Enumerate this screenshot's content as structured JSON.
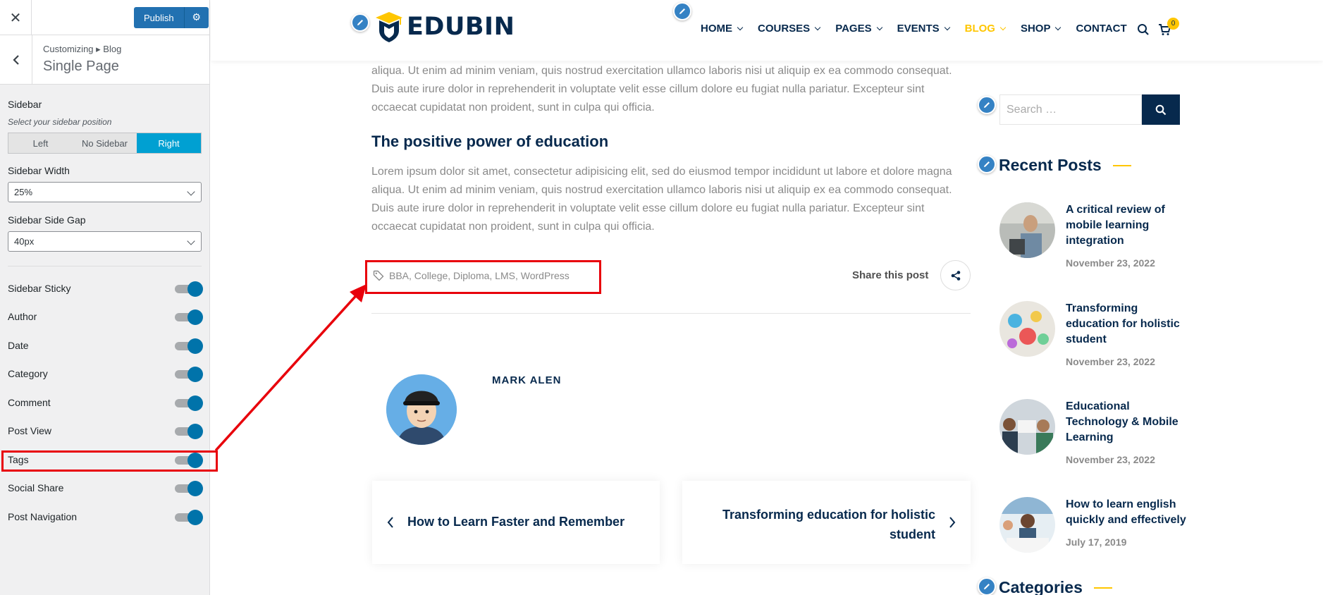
{
  "customizer": {
    "publish_label": "Publish",
    "breadcrumb": "Customizing ▸ Blog",
    "section_title": "Single Page",
    "sidebar": {
      "label": "Sidebar",
      "description": "Select your sidebar position",
      "options": [
        "Left",
        "No Sidebar",
        "Right"
      ],
      "selected": "Right"
    },
    "sidebar_width": {
      "label": "Sidebar Width",
      "value": "25%"
    },
    "sidebar_side_gap": {
      "label": "Sidebar Side Gap",
      "value": "40px"
    },
    "toggles": [
      {
        "label": "Sidebar Sticky",
        "on": true
      },
      {
        "label": "Author",
        "on": true
      },
      {
        "label": "Date",
        "on": true
      },
      {
        "label": "Category",
        "on": true
      },
      {
        "label": "Comment",
        "on": true
      },
      {
        "label": "Post View",
        "on": true
      },
      {
        "label": "Tags",
        "on": true
      },
      {
        "label": "Social Share",
        "on": true
      },
      {
        "label": "Post Navigation",
        "on": true
      }
    ]
  },
  "site": {
    "logo_text": "EDUBIN",
    "nav": [
      {
        "label": "HOME",
        "dropdown": true
      },
      {
        "label": "COURSES",
        "dropdown": true
      },
      {
        "label": "PAGES",
        "dropdown": true
      },
      {
        "label": "EVENTS",
        "dropdown": true
      },
      {
        "label": "BLOG",
        "dropdown": true,
        "active": true
      },
      {
        "label": "SHOP",
        "dropdown": true
      },
      {
        "label": "CONTACT",
        "dropdown": false
      }
    ],
    "cart_count": "0"
  },
  "post": {
    "para1_lines": [
      "aliqua. Ut enim ad minim veniam, quis nostrud exercitation ullamco laboris nisi ut aliquip ex ea commodo consequat.",
      "Duis aute irure dolor in reprehenderit in voluptate velit esse cillum dolore eu fugiat nulla pariatur. Excepteur sint",
      "occaecat cupidatat non proident, sunt in culpa qui officia."
    ],
    "heading": "The positive power of education",
    "para2_lines": [
      "Lorem ipsum dolor sit amet, consectetur adipisicing elit, sed do eiusmod tempor incididunt ut labore et dolore magna",
      "aliqua. Ut enim ad minim veniam, quis nostrud exercitation ullamco laboris nisi ut aliquip ex ea commodo consequat.",
      "Duis aute irure dolor in reprehenderit in voluptate velit esse cillum dolore eu fugiat nulla pariatur. Excepteur sint",
      "occaecat cupidatat non proident, sunt in culpa qui officia."
    ],
    "tags": "BBA, College, Diploma, LMS, WordPress",
    "share_label": "Share this post",
    "author_name": "MARK ALEN",
    "prev_title": "How to Learn Faster and Remember",
    "next_title_lines": [
      "Transforming education for holistic",
      "student"
    ]
  },
  "sidebar": {
    "search_placeholder": "Search …",
    "recent_posts_title": "Recent Posts",
    "recent_posts": [
      {
        "title_lines": [
          "A critical review of",
          "mobile learning",
          "integration"
        ],
        "date": "November 23, 2022"
      },
      {
        "title_lines": [
          "Transforming",
          "education for holistic",
          "student"
        ],
        "date": "November 23, 2022"
      },
      {
        "title_lines": [
          "Educational",
          "Technology & Mobile",
          "Learning"
        ],
        "date": "November 23, 2022"
      },
      {
        "title_lines": [
          "How to learn english",
          "quickly and effectively"
        ],
        "date": "July 17, 2019"
      }
    ],
    "categories_title": "Categories"
  },
  "colors": {
    "accent": "#ffc600",
    "navy": "#07294d",
    "wp_blue": "#2271b1",
    "toggle_on": "#0073aa",
    "annotation_red": "#e8000b"
  }
}
